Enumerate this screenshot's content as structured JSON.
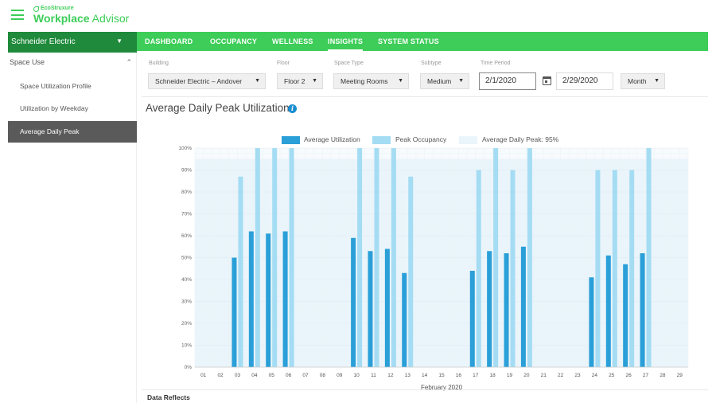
{
  "app": {
    "brand_small": "EcoStruxure",
    "brand_bold": "Workplace",
    "brand_light": " Advisor",
    "accent_color": "#3dcd58",
    "dark_green": "#1f8a3b"
  },
  "sidebar": {
    "company": "Schneider Electric",
    "section": "Space Use",
    "items": [
      {
        "label": "Space Utilization Profile",
        "active": false
      },
      {
        "label": "Utilization by Weekday",
        "active": false
      },
      {
        "label": "Average Daily Peak",
        "active": true
      }
    ]
  },
  "tabs": [
    {
      "label": "DASHBOARD",
      "active": false
    },
    {
      "label": "OCCUPANCY",
      "active": false
    },
    {
      "label": "WELLNESS",
      "active": false
    },
    {
      "label": "INSIGHTS",
      "active": true
    },
    {
      "label": "SYSTEM STATUS",
      "active": false
    }
  ],
  "filters": {
    "building": {
      "label": "Building",
      "value": "Schneider Electric – Andover"
    },
    "floor": {
      "label": "Floor",
      "value": "Floor 2"
    },
    "space_type": {
      "label": "Space Type",
      "value": "Meeting Rooms"
    },
    "subtype": {
      "label": "Subtype",
      "value": "Medium"
    },
    "time_period": {
      "label": "Time Period",
      "start": "2/1/2020",
      "end": "2/29/2020"
    },
    "granularity": {
      "value": "Month"
    }
  },
  "page": {
    "title": "Average Daily Peak Utilization",
    "info_glyph": "i",
    "footer_note": "Data Reflects"
  },
  "legend": [
    {
      "label": "Average Utilization",
      "color": "#2a9fd8"
    },
    {
      "label": "Peak Occupancy",
      "color": "#a4dcf3"
    },
    {
      "label": "Average Daily Peak: 95%",
      "color": "#eaf5fb"
    }
  ],
  "chart_data": {
    "type": "bar",
    "xlabel": "February 2020",
    "ylabel": "",
    "ylim": [
      0,
      100
    ],
    "y_ticks": [
      "0%",
      "10%",
      "20%",
      "30%",
      "40%",
      "50%",
      "60%",
      "70%",
      "80%",
      "90%",
      "100%"
    ],
    "categories": [
      "01",
      "02",
      "03",
      "04",
      "05",
      "06",
      "07",
      "08",
      "09",
      "10",
      "11",
      "12",
      "13",
      "14",
      "15",
      "16",
      "17",
      "18",
      "19",
      "20",
      "21",
      "22",
      "23",
      "24",
      "25",
      "26",
      "27",
      "28",
      "29"
    ],
    "series": [
      {
        "name": "Average Utilization",
        "color": "#2a9fd8",
        "values": [
          null,
          null,
          50,
          62,
          61,
          62,
          null,
          null,
          null,
          59,
          53,
          54,
          43,
          null,
          null,
          null,
          44,
          53,
          52,
          55,
          null,
          null,
          null,
          41,
          51,
          47,
          52,
          null,
          null
        ]
      },
      {
        "name": "Peak Occupancy",
        "color": "#a4dcf3",
        "values": [
          null,
          null,
          87,
          100,
          100,
          100,
          null,
          null,
          null,
          100,
          100,
          100,
          87,
          null,
          null,
          null,
          90,
          100,
          90,
          100,
          null,
          null,
          null,
          90,
          90,
          90,
          100,
          null,
          null
        ]
      }
    ],
    "average_daily_peak": 95,
    "grid": true
  }
}
